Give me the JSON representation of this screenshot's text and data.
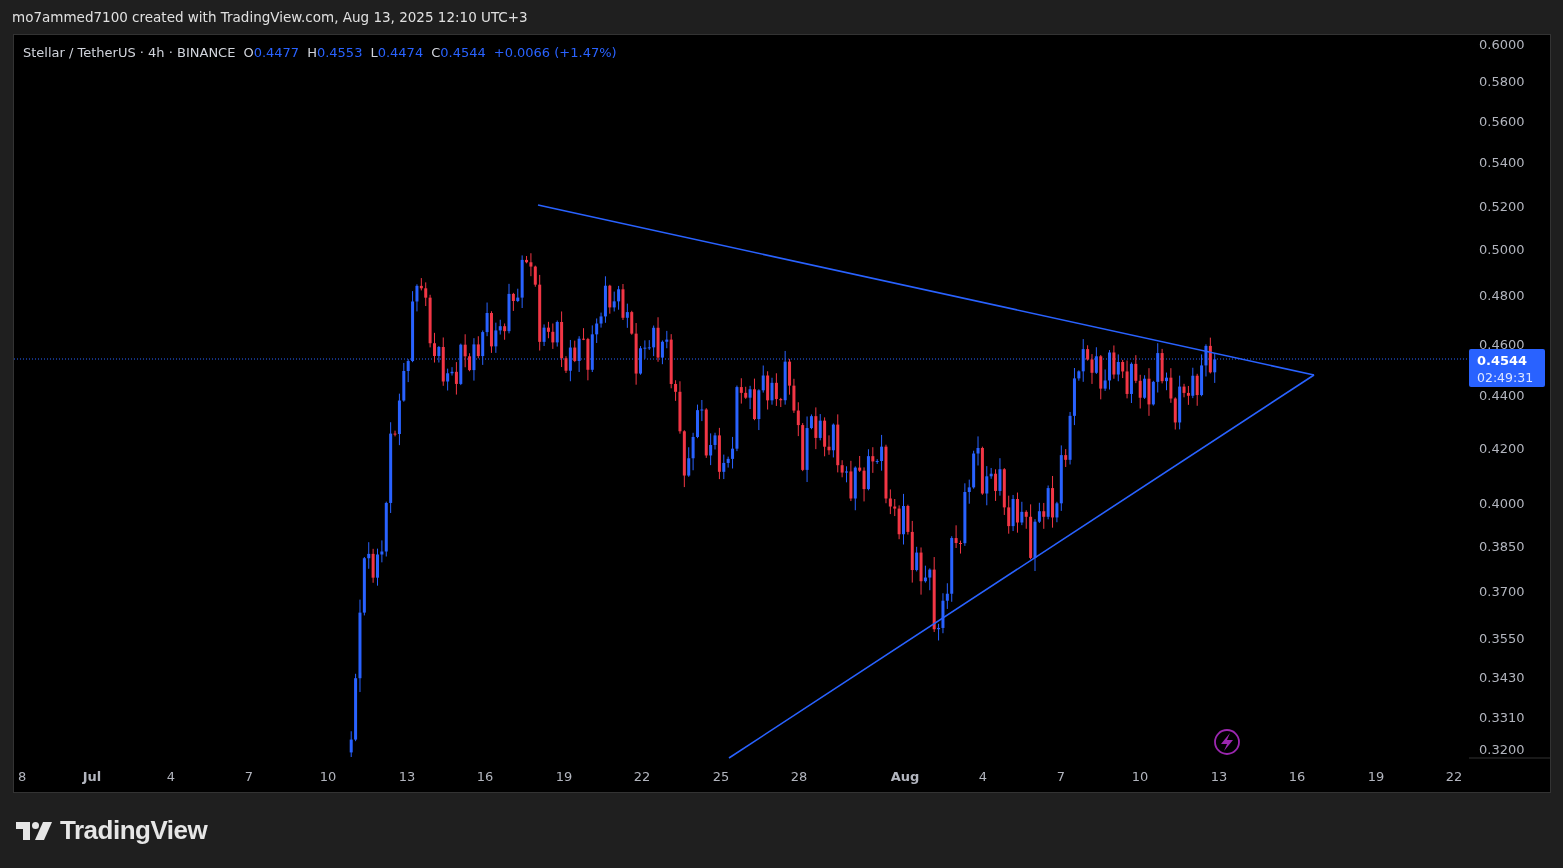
{
  "attribution": "mo7ammed7100 created with TradingView.com, Aug 13, 2025 12:10 UTC+3",
  "legend": {
    "symbol": "Stellar / TetherUS · 4h · BINANCE",
    "values": [
      {
        "label": "O",
        "value": "0.4477"
      },
      {
        "label": "H",
        "value": "0.4553"
      },
      {
        "label": "L",
        "value": "0.4474"
      },
      {
        "label": "C",
        "value": "0.4544"
      }
    ],
    "change": "+0.0066 (+1.47%)"
  },
  "price_axis": {
    "labels": [
      "0.6000",
      "0.5800",
      "0.5600",
      "0.5400",
      "0.5200",
      "0.5000",
      "0.4800",
      "0.4600",
      "0.4400",
      "0.4200",
      "0.4000",
      "0.3850",
      "0.3700",
      "0.3550",
      "0.3430",
      "0.3310",
      "0.3200"
    ]
  },
  "price_tag": {
    "price": "0.4544",
    "countdown": "02:49:31"
  },
  "time_axis": {
    "labels": [
      {
        "text": "8",
        "major": false
      },
      {
        "text": "Jul",
        "major": true
      },
      {
        "text": "4",
        "major": false
      },
      {
        "text": "7",
        "major": false
      },
      {
        "text": "10",
        "major": false
      },
      {
        "text": "13",
        "major": false
      },
      {
        "text": "16",
        "major": false
      },
      {
        "text": "19",
        "major": false
      },
      {
        "text": "22",
        "major": false
      },
      {
        "text": "25",
        "major": false
      },
      {
        "text": "28",
        "major": false
      },
      {
        "text": "Aug",
        "major": true
      },
      {
        "text": "4",
        "major": false
      },
      {
        "text": "7",
        "major": false
      },
      {
        "text": "10",
        "major": false
      },
      {
        "text": "13",
        "major": false
      },
      {
        "text": "16",
        "major": false
      },
      {
        "text": "19",
        "major": false
      },
      {
        "text": "22",
        "major": false
      }
    ]
  },
  "footer": {
    "logo_text": "TradingView"
  }
}
